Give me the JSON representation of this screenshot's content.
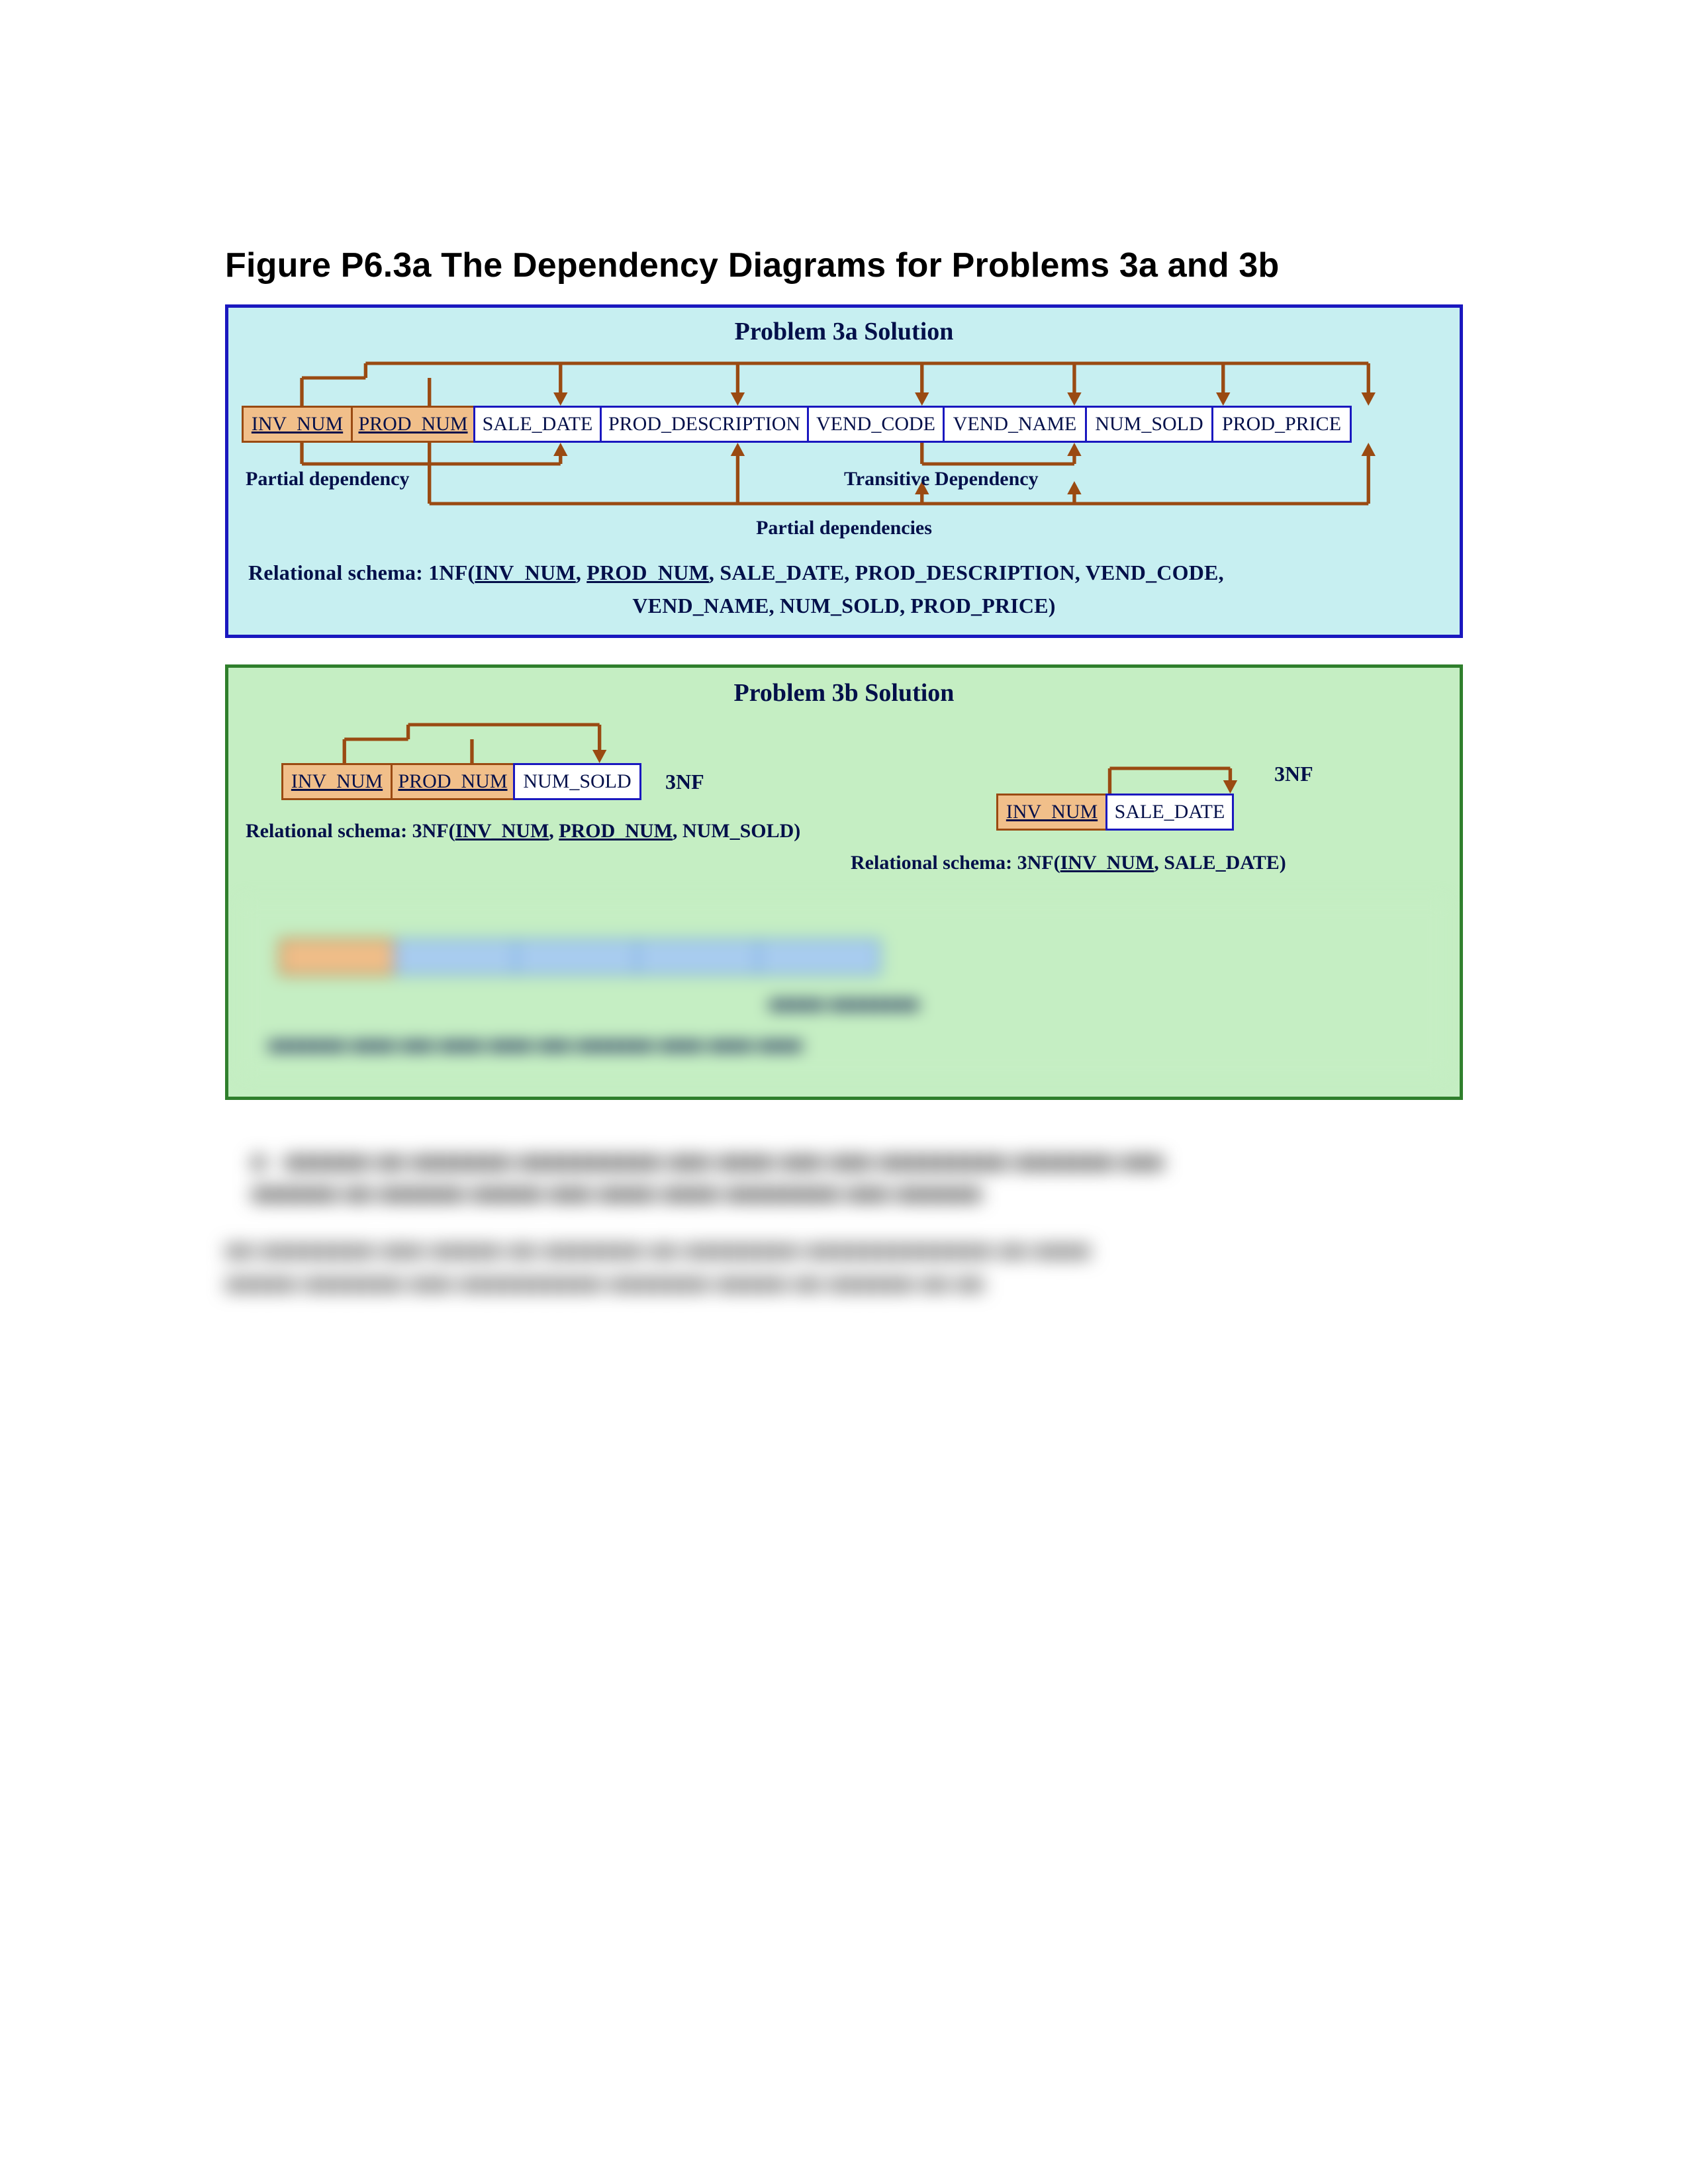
{
  "title": "Figure P6.3a The Dependency Diagrams for Problems 3a and 3b",
  "p3a": {
    "title": "Problem 3a Solution",
    "attrs": {
      "inv": "INV_NUM",
      "pnum": "PROD_NUM",
      "sdate": "SALE_DATE",
      "pdesc": "PROD_DESCRIPTION",
      "vcode": "VEND_CODE",
      "vname": "VEND_NAME",
      "nsold": "NUM_SOLD",
      "pprice": "PROD_PRICE"
    },
    "labels": {
      "partial": "Partial dependency",
      "trans": "Transitive Dependency",
      "partials": "Partial dependencies"
    },
    "schema_prefix": "Relational schema: 1NF(",
    "schema_line2": "VEND_NAME, NUM_SOLD, PROD_PRICE)"
  },
  "p3b": {
    "title": "Problem 3b Solution",
    "nf_tag": "3NF",
    "left": {
      "inv": "INV_NUM",
      "pnum": "PROD_NUM",
      "nsold": "NUM_SOLD",
      "schema_prefix": "Relational schema: 3NF("
    },
    "right": {
      "inv": "INV_NUM",
      "sdate": "SALE_DATE",
      "schema_prefix": "Relational schema: 3NF("
    }
  },
  "comma": ", ",
  "rparen": ")"
}
